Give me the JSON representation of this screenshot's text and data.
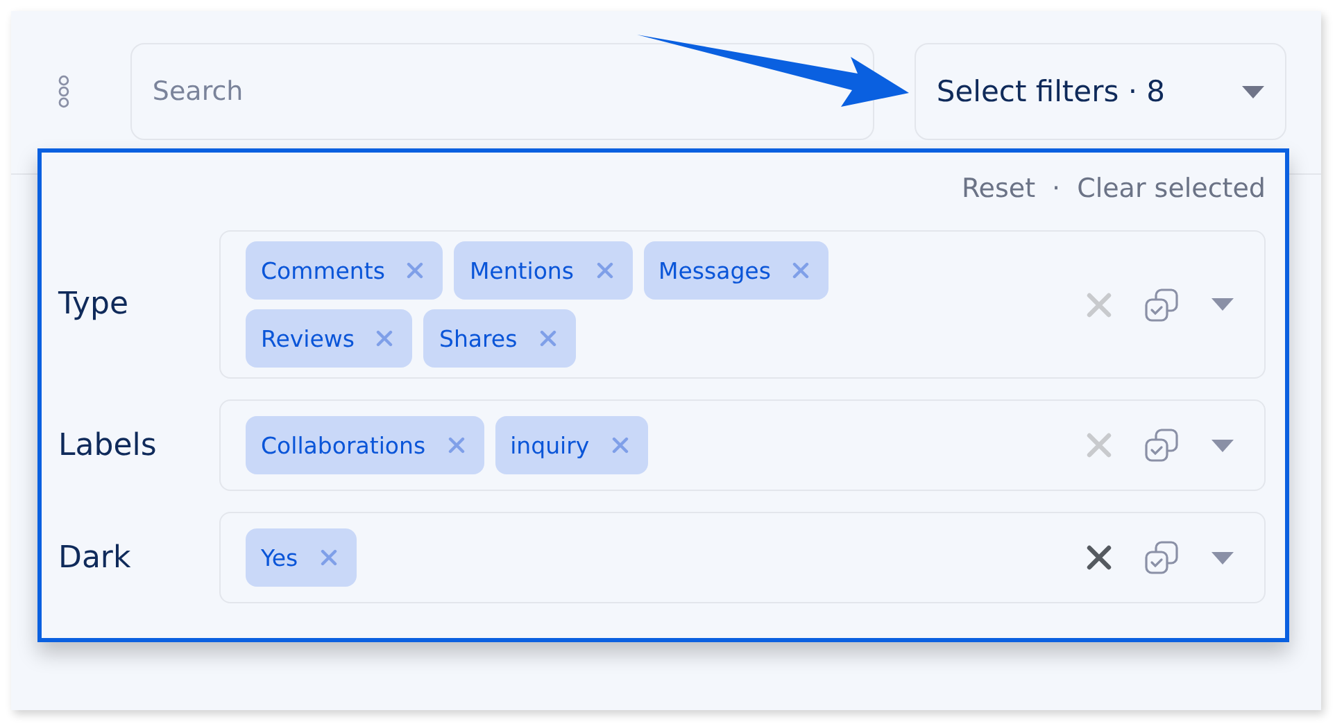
{
  "search": {
    "placeholder": "Search"
  },
  "filter_button": {
    "label": "Select filters · 8"
  },
  "popover": {
    "actions": [
      "Reset",
      "·",
      "Clear selected"
    ],
    "rows": [
      {
        "label": "Type",
        "tags": [
          "Comments",
          "Mentions",
          "Messages",
          "Reviews",
          "Shares"
        ],
        "clear_active": false
      },
      {
        "label": "Labels",
        "tags": [
          "Collaborations",
          "inquiry"
        ],
        "clear_active": false
      },
      {
        "label": "Dark",
        "tags": [
          "Yes"
        ],
        "clear_active": true
      }
    ]
  }
}
